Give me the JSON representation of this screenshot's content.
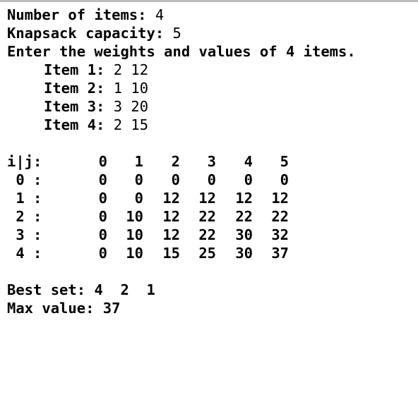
{
  "header": {
    "num_items_label": "Number of items:",
    "num_items_value": "4",
    "capacity_label": "Knapsack capacity:",
    "capacity_value": "5",
    "prompt": "Enter the weights and values of 4 items."
  },
  "items": [
    {
      "label": "Item 1:",
      "values": "2 12"
    },
    {
      "label": "Item 2:",
      "values": "1 10"
    },
    {
      "label": "Item 3:",
      "values": "3 20"
    },
    {
      "label": "Item 4:",
      "values": "2 15"
    }
  ],
  "table": {
    "corner": "i|j:",
    "columns": [
      "0",
      "1",
      "2",
      "3",
      "4",
      "5"
    ],
    "rows": [
      {
        "label": " 0 :",
        "cells": [
          "0",
          "0",
          "0",
          "0",
          "0",
          "0"
        ]
      },
      {
        "label": " 1 :",
        "cells": [
          "0",
          "0",
          "12",
          "12",
          "12",
          "12"
        ]
      },
      {
        "label": " 2 :",
        "cells": [
          "0",
          "10",
          "12",
          "22",
          "22",
          "22"
        ]
      },
      {
        "label": " 3 :",
        "cells": [
          "0",
          "10",
          "12",
          "22",
          "30",
          "32"
        ]
      },
      {
        "label": " 4 :",
        "cells": [
          "0",
          "10",
          "15",
          "25",
          "30",
          "37"
        ]
      }
    ]
  },
  "result": {
    "best_set_label": "Best set:",
    "best_set_value": "4  2  1",
    "max_value_label": "Max value:",
    "max_value_value": "37"
  }
}
